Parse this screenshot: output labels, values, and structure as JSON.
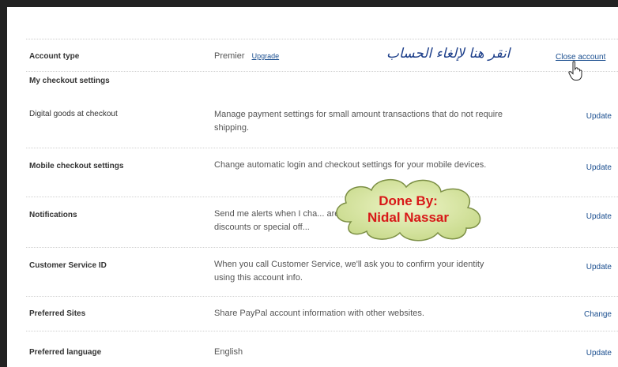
{
  "account": {
    "label": "Account type",
    "value": "Premier",
    "upgrade": "Upgrade",
    "close_link": "Close account",
    "arabic_note": "انقر هنا لإلغاء الحساب"
  },
  "section_title": "My checkout settings",
  "rows": [
    {
      "label": "Digital goods at checkout",
      "desc": "Manage payment settings for small amount transactions that do not require shipping.",
      "action": "Update"
    },
    {
      "label": "Mobile checkout settings",
      "desc": "Change automatic login and checkout settings for your mobile devices.",
      "action": "Update"
    },
    {
      "label": "Notifications",
      "desc": "Send me alerts when I cha... are discounts or special off...",
      "action": "Update"
    },
    {
      "label": "Customer Service ID",
      "desc": "When you call Customer Service, we'll ask you to confirm your identity using this account info.",
      "action": "Update"
    },
    {
      "label": "Preferred Sites",
      "desc": "Share PayPal account information with other websites.",
      "action": "Change"
    },
    {
      "label": "Preferred language",
      "desc": "English",
      "action": "Update"
    }
  ],
  "overlay": {
    "line1": "Done By:",
    "line2": "Nidal Nassar"
  }
}
